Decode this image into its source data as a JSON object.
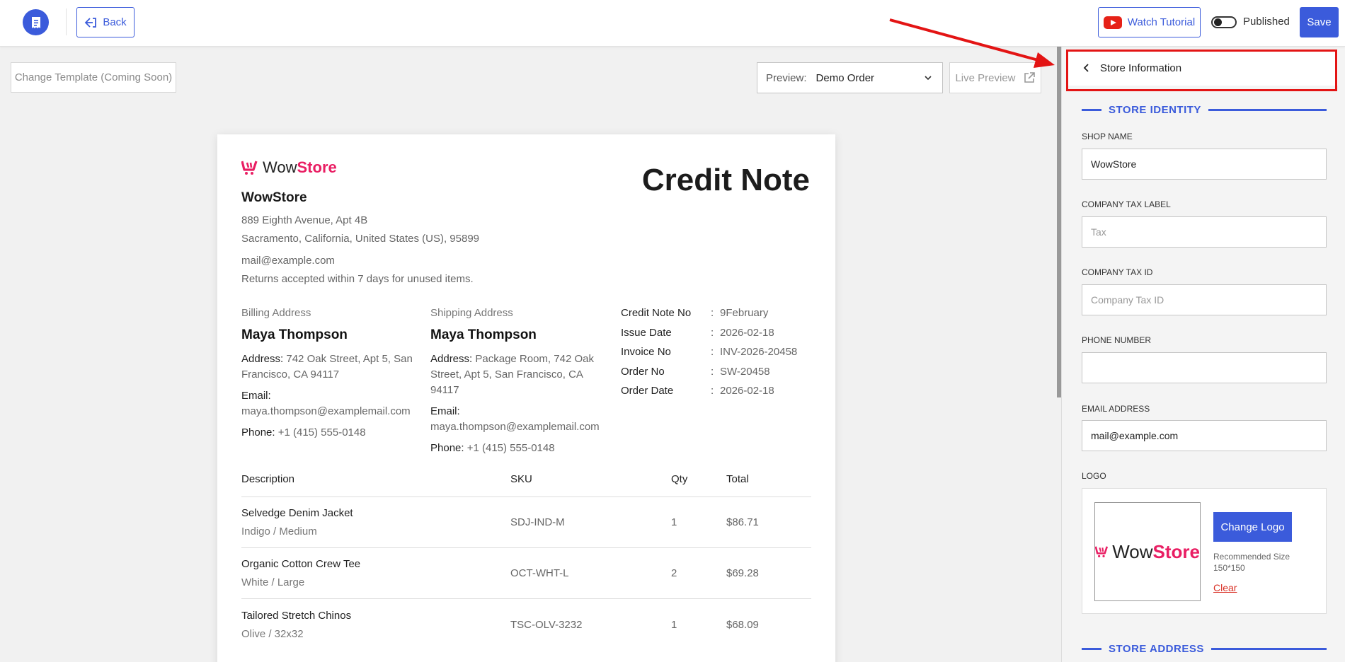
{
  "header": {
    "back_label": "Back",
    "watch_tutorial_label": "Watch Tutorial",
    "published_label": "Published",
    "published_on": false,
    "save_label": "Save"
  },
  "toolbar": {
    "change_template_label": "Change Template (Coming Soon)",
    "preview_prefix": "Preview:",
    "preview_value": "Demo Order",
    "live_preview_label": "Live Preview"
  },
  "document": {
    "brand_word": "Wow",
    "brand_word_accent": "Store",
    "title": "Credit Note",
    "shop_name": "WowStore",
    "address_line1": "889 Eighth Avenue, Apt 4B",
    "address_line2": "Sacramento, California, United States (US), 95899",
    "email": "mail@example.com",
    "returns_note": "Returns accepted within 7 days for unused items.",
    "billing": {
      "label": "Billing Address",
      "name": "Maya Thompson",
      "address_key": "Address:",
      "address": "742 Oak Street, Apt 5, San Francisco, CA 94117",
      "email_key": "Email:",
      "email": "maya.thompson@examplemail.com",
      "phone_key": "Phone:",
      "phone": "+1 (415) 555-0148"
    },
    "shipping": {
      "label": "Shipping Address",
      "name": "Maya Thompson",
      "address_key": "Address:",
      "address": "Package Room, 742 Oak Street, Apt 5, San Francisco, CA 94117",
      "email_key": "Email:",
      "email": "maya.thompson@examplemail.com",
      "phone_key": "Phone:",
      "phone": "+1 (415) 555-0148"
    },
    "meta": [
      {
        "key": "Credit Note No",
        "value": "9February"
      },
      {
        "key": "Issue Date",
        "value": "2026-02-18"
      },
      {
        "key": "Invoice No",
        "value": "INV-2026-20458"
      },
      {
        "key": "Order No",
        "value": "SW-20458"
      },
      {
        "key": "Order Date",
        "value": "2026-02-18"
      }
    ],
    "meta_separator": ":",
    "columns": {
      "description": "Description",
      "sku": "SKU",
      "qty": "Qty",
      "total": "Total"
    },
    "items": [
      {
        "name": "Selvedge Denim Jacket",
        "variant": "Indigo / Medium",
        "sku": "SDJ-IND-M",
        "qty": "1",
        "total": "$86.71"
      },
      {
        "name": "Organic Cotton Crew Tee",
        "variant": "White / Large",
        "sku": "OCT-WHT-L",
        "qty": "2",
        "total": "$69.28"
      },
      {
        "name": "Tailored Stretch Chinos",
        "variant": "Olive / 32x32",
        "sku": "TSC-OLV-3232",
        "qty": "1",
        "total": "$68.09"
      }
    ]
  },
  "panel": {
    "title": "Store Information",
    "section_identity": "STORE IDENTITY",
    "shop_name_label": "SHOP NAME",
    "shop_name_value": "WowStore",
    "tax_label_label": "COMPANY TAX LABEL",
    "tax_label_placeholder": "Tax",
    "tax_id_label": "COMPANY TAX ID",
    "tax_id_placeholder": "Company Tax ID",
    "phone_label": "PHONE NUMBER",
    "phone_value": "",
    "email_label": "EMAIL ADDRESS",
    "email_value": "mail@example.com",
    "logo_label": "LOGO",
    "change_logo_label": "Change Logo",
    "recommended_size": "Recommended Size 150*150",
    "clear_label": "Clear",
    "section_address": "STORE ADDRESS"
  },
  "colors": {
    "accent": "#3b5bdb",
    "brand_pink": "#e91e63",
    "annotation_red": "#e31414"
  },
  "icons": [
    "receipt-icon",
    "back-arrow-icon",
    "youtube-icon",
    "chevron-down-icon",
    "external-link-icon",
    "chevron-left-icon",
    "cart-logo-icon"
  ]
}
